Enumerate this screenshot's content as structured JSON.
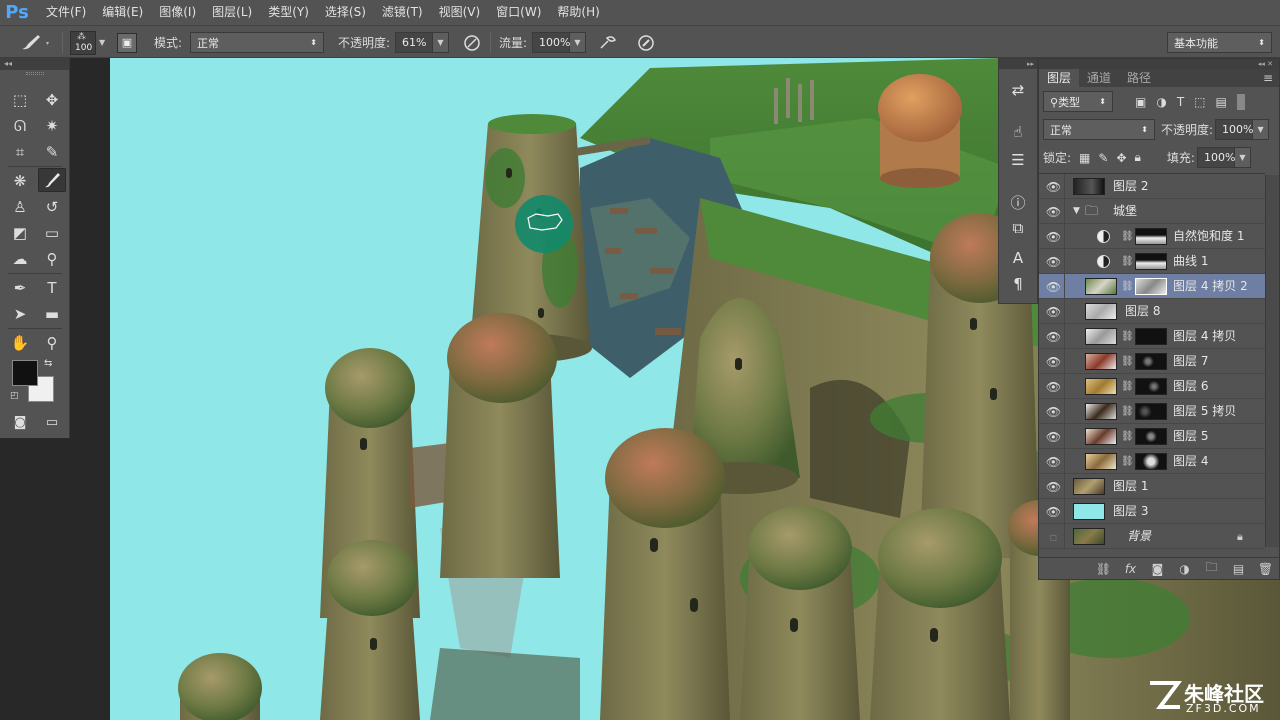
{
  "menubar": {
    "logo": "Ps",
    "items": [
      "文件(F)",
      "编辑(E)",
      "图像(I)",
      "图层(L)",
      "类型(Y)",
      "选择(S)",
      "滤镜(T)",
      "视图(V)",
      "窗口(W)",
      "帮助(H)"
    ]
  },
  "options": {
    "brush_size": "100",
    "mode_label": "模式:",
    "mode_value": "正常",
    "opacity_label": "不透明度:",
    "opacity_value": "61%",
    "flow_label": "流量:",
    "flow_value": "100%",
    "workspace": "基本功能"
  },
  "layers_panel": {
    "tabs": [
      "图层",
      "通道",
      "路径"
    ],
    "filter_kind": "类型",
    "blend_mode": "正常",
    "opacity_label": "不透明度:",
    "opacity_value": "100%",
    "lock_label": "锁定:",
    "fill_label": "填充:",
    "fill_value": "100%",
    "layers": [
      {
        "name": "图层 2",
        "visible": true
      },
      {
        "name": "城堡",
        "visible": true
      },
      {
        "name": "自然饱和度 1",
        "visible": true
      },
      {
        "name": "曲线 1",
        "visible": true
      },
      {
        "name": "图层 4 拷贝 2",
        "visible": true,
        "selected": true
      },
      {
        "name": "图层 8",
        "visible": true
      },
      {
        "name": "图层 4 拷贝",
        "visible": true
      },
      {
        "name": "图层 7",
        "visible": true
      },
      {
        "name": "图层 6",
        "visible": true
      },
      {
        "name": "图层 5 拷贝",
        "visible": true
      },
      {
        "name": "图层 5",
        "visible": true
      },
      {
        "name": "图层 4",
        "visible": true
      },
      {
        "name": "图层 1",
        "visible": true
      },
      {
        "name": "图层 3",
        "visible": true
      },
      {
        "name": "背景",
        "visible": false
      }
    ]
  },
  "watermark": {
    "brand": "朱峰社区",
    "site": "ZF3D.COM"
  },
  "colors": {
    "canvas_sky": "#8fe7e7",
    "panel_bg": "#535353",
    "selected_row": "#6f7fa4",
    "accent": "#4ea9ff"
  }
}
